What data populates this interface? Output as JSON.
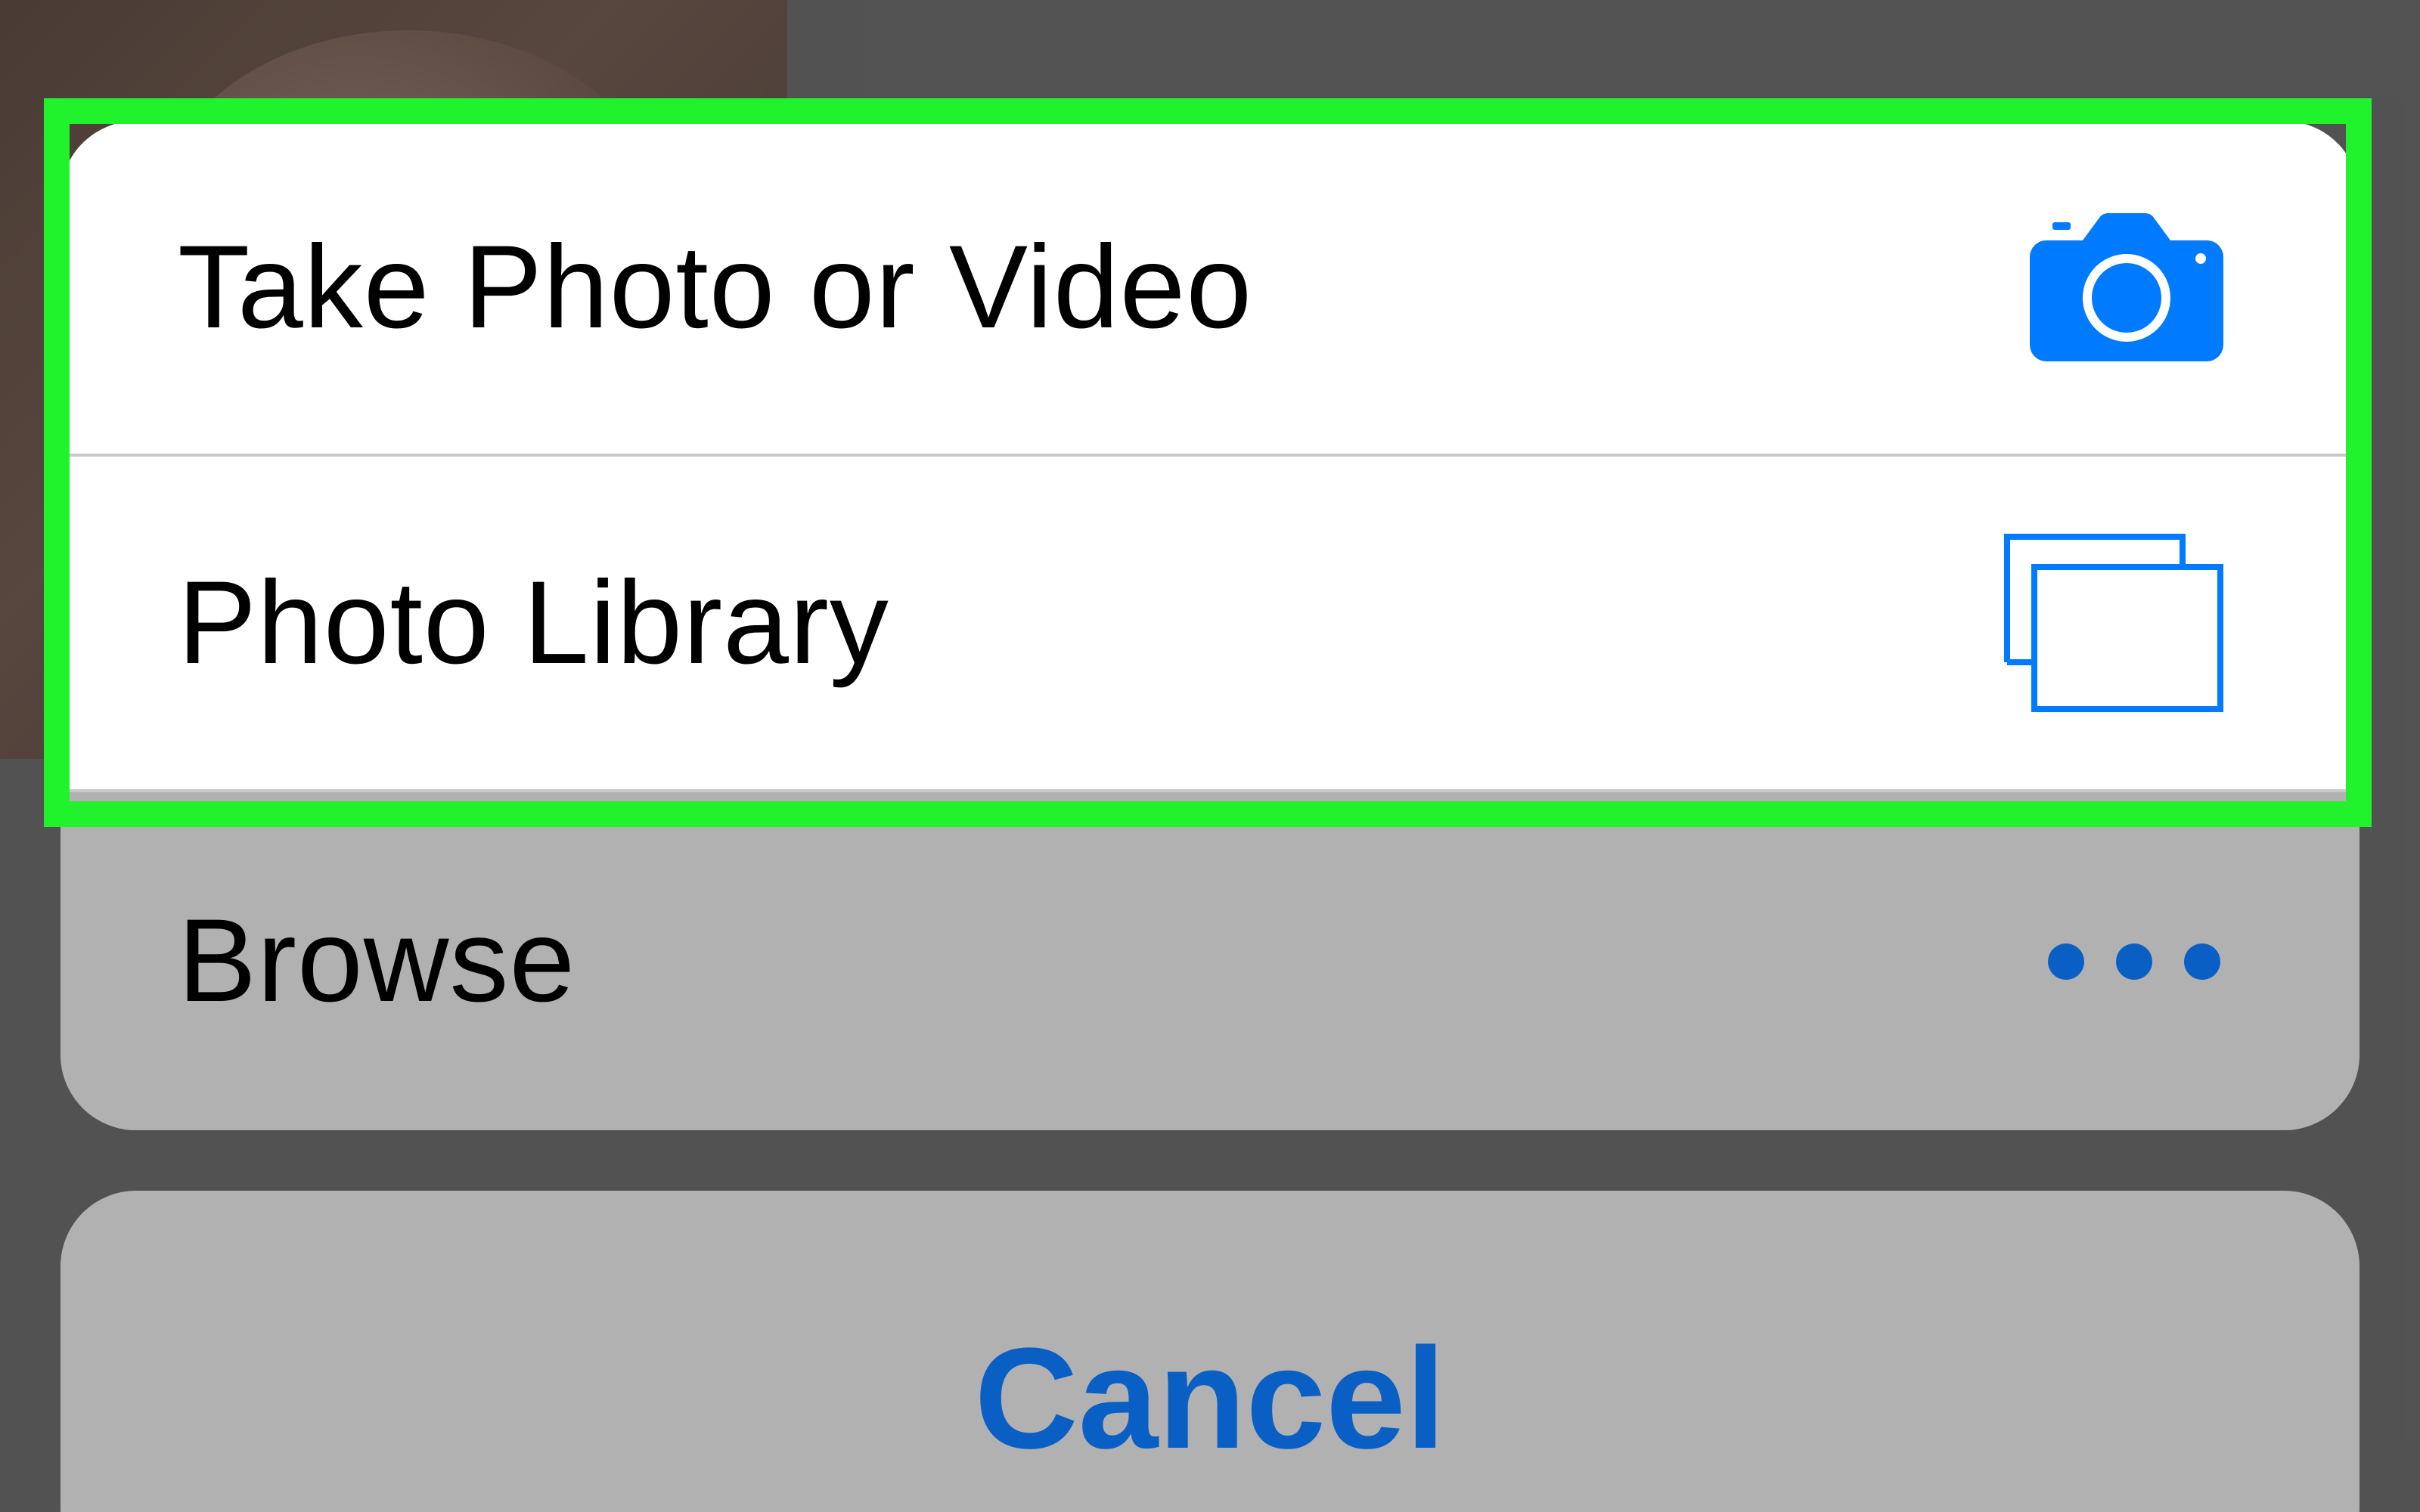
{
  "action_sheet": {
    "items": [
      {
        "label": "Take Photo or Video",
        "icon": "camera-icon"
      },
      {
        "label": "Photo Library",
        "icon": "photo-library-icon"
      },
      {
        "label": "Browse",
        "icon": "more-dots-icon"
      }
    ],
    "cancel_label": "Cancel"
  },
  "colors": {
    "accent": "#007AFF",
    "cancel_text": "#0A5FC4",
    "highlight_frame": "#20F22C",
    "dim_overlay": "#6E6E6E"
  }
}
